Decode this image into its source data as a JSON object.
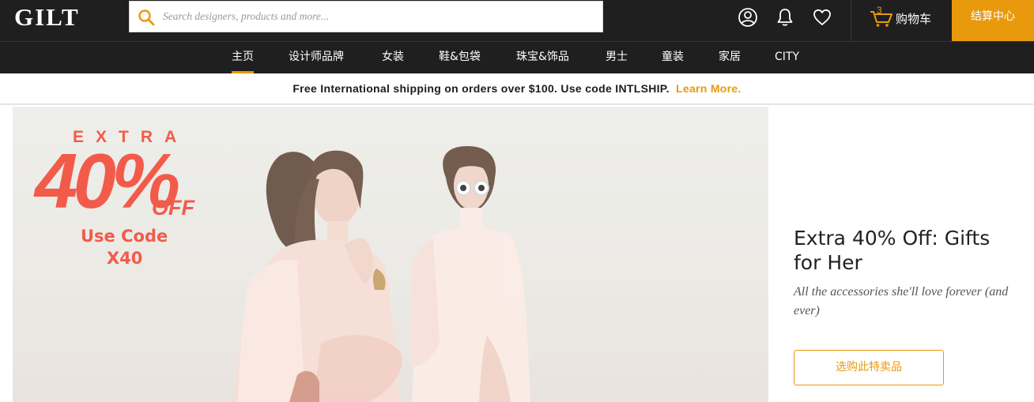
{
  "header": {
    "logo": "GILT",
    "search_placeholder": "Search designers, products and more...",
    "icons": [
      "search-icon",
      "user-icon",
      "bell-icon",
      "heart-icon",
      "cart-icon"
    ],
    "cart_count": "3",
    "cart_label": "购物车",
    "checkout_label": "结算中心"
  },
  "nav": {
    "items": [
      {
        "label": "主页",
        "active": true
      },
      {
        "label": "设计师品牌"
      },
      {
        "label": "女装"
      },
      {
        "label": "鞋&包袋"
      },
      {
        "label": "珠宝&饰品"
      },
      {
        "label": "男士"
      },
      {
        "label": "童装"
      },
      {
        "label": "家居"
      },
      {
        "label": "CITY"
      }
    ]
  },
  "promo": {
    "text": "Free International shipping on orders over $100. Use code INTLSHIP.",
    "link": "Learn More."
  },
  "hero": {
    "extra": "EXTRA",
    "percent": "40%",
    "off": "OFF",
    "code_line1": "Use Code",
    "code_line2": "X40",
    "title": "Extra 40% Off: Gifts for Her",
    "subtitle": "All the accessories she'll love forever (and ever)",
    "button": "选购此特卖品"
  },
  "colors": {
    "accent": "#e89a0c",
    "topbar": "#1f1f1f",
    "promo_red": "#f25b4a"
  }
}
